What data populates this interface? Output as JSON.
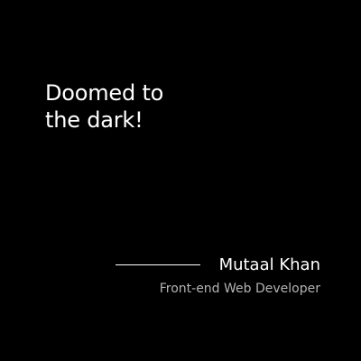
{
  "quote": {
    "line1": "Doomed to",
    "line2": "the dark!"
  },
  "author": {
    "name": "Mutaal Khan",
    "role": "Front-end Web Developer"
  },
  "colors": {
    "background": "#000000",
    "text": "#ffffff",
    "subtext": "#b3b3b3"
  }
}
